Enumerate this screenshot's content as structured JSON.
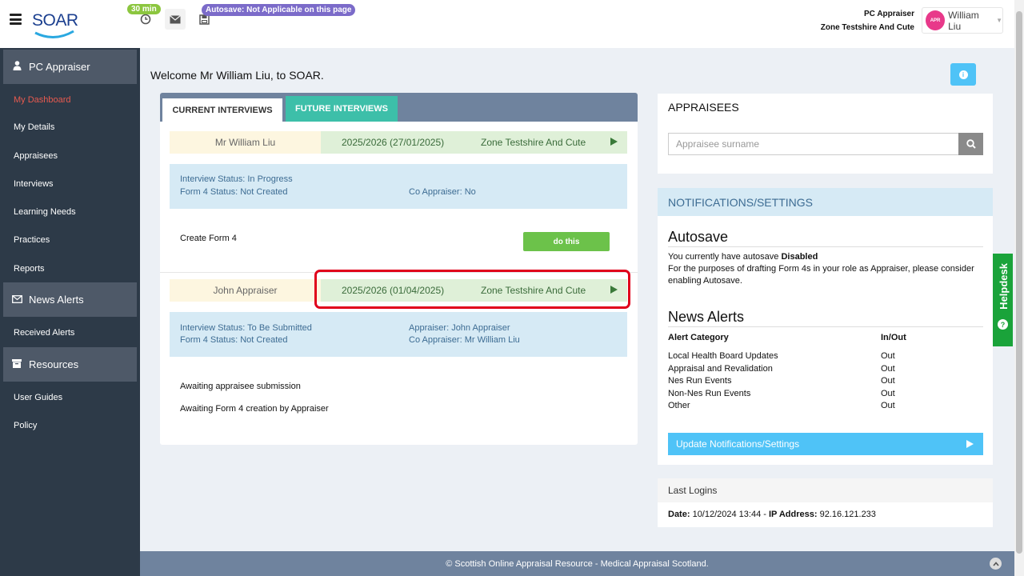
{
  "header": {
    "logo_text": "SOAR",
    "timer_badge": "30 min",
    "autosave_badge": "Autosave: Not Applicable on this page",
    "role": "PC Appraiser",
    "zone": "Zone Testshire And Cute",
    "avatar_initials": "APR",
    "user_name": "William Liu"
  },
  "sidebar": {
    "sections": [
      {
        "title": "PC Appraiser",
        "icon": "user-icon"
      },
      {
        "title": "News Alerts",
        "icon": "envelope-icon"
      },
      {
        "title": "Resources",
        "icon": "archive-icon"
      }
    ],
    "items": [
      "My Dashboard",
      "My Details",
      "Appraisees",
      "Interviews",
      "Learning Needs",
      "Practices",
      "Reports",
      "Received Alerts",
      "User Guides",
      "Policy"
    ]
  },
  "main": {
    "welcome": "Welcome Mr William Liu, to SOAR.",
    "tabs": [
      "CURRENT INTERVIEWS",
      "FUTURE INTERVIEWS"
    ],
    "interviews": [
      {
        "name": "Mr William Liu",
        "year": "2025/2026 (27/01/2025)",
        "zone": "Zone Testshire And Cute",
        "status": "Interview Status: In Progress",
        "form4": "Form 4 Status: Not Created",
        "appraiser": "",
        "co_appraiser": "Co Appraiser: No",
        "actions": [
          "Create Form 4"
        ],
        "button": "do this"
      },
      {
        "name": "John Appraiser",
        "year": "2025/2026 (01/04/2025)",
        "zone": "Zone Testshire And Cute",
        "status": "Interview Status: To Be Submitted",
        "form4": "Form 4 Status: Not Created",
        "appraiser": "Appraiser: John Appraiser",
        "co_appraiser": "Co Appraiser: Mr William Liu",
        "actions": [
          "Awaiting appraisee submission",
          "Awaiting Form 4 creation by Appraiser"
        ]
      }
    ]
  },
  "appraisees": {
    "title": "APPRAISEES",
    "search_placeholder": "Appraisee surname"
  },
  "notifications": {
    "title": "NOTIFICATIONS/SETTINGS",
    "autosave_title": "Autosave",
    "autosave_text_pre": "You currently have autosave ",
    "autosave_state": "Disabled",
    "autosave_text_2": "For the purposes of drafting Form 4s in your role as Appraiser, please consider enabling Autosave.",
    "news_title": "News Alerts",
    "col_category": "Alert Category",
    "col_inout": "In/Out",
    "alerts": [
      {
        "category": "Local Health Board Updates",
        "value": "Out"
      },
      {
        "category": "Appraisal and Revalidation",
        "value": "Out"
      },
      {
        "category": "Nes Run Events",
        "value": "Out"
      },
      {
        "category": "Non-Nes Run Events",
        "value": "Out"
      },
      {
        "category": "Other",
        "value": "Out"
      }
    ],
    "update_button": "Update Notifications/Settings"
  },
  "last_logins": {
    "title": "Last Logins",
    "date_label": "Date:",
    "date_value": " 10/12/2024 13:44 - ",
    "ip_label": "IP Address:",
    "ip_value": " 92.16.121.233"
  },
  "helpdesk": "Helpdesk",
  "footer": "© Scottish Online Appraisal Resource - Medical Appraisal Scotland."
}
